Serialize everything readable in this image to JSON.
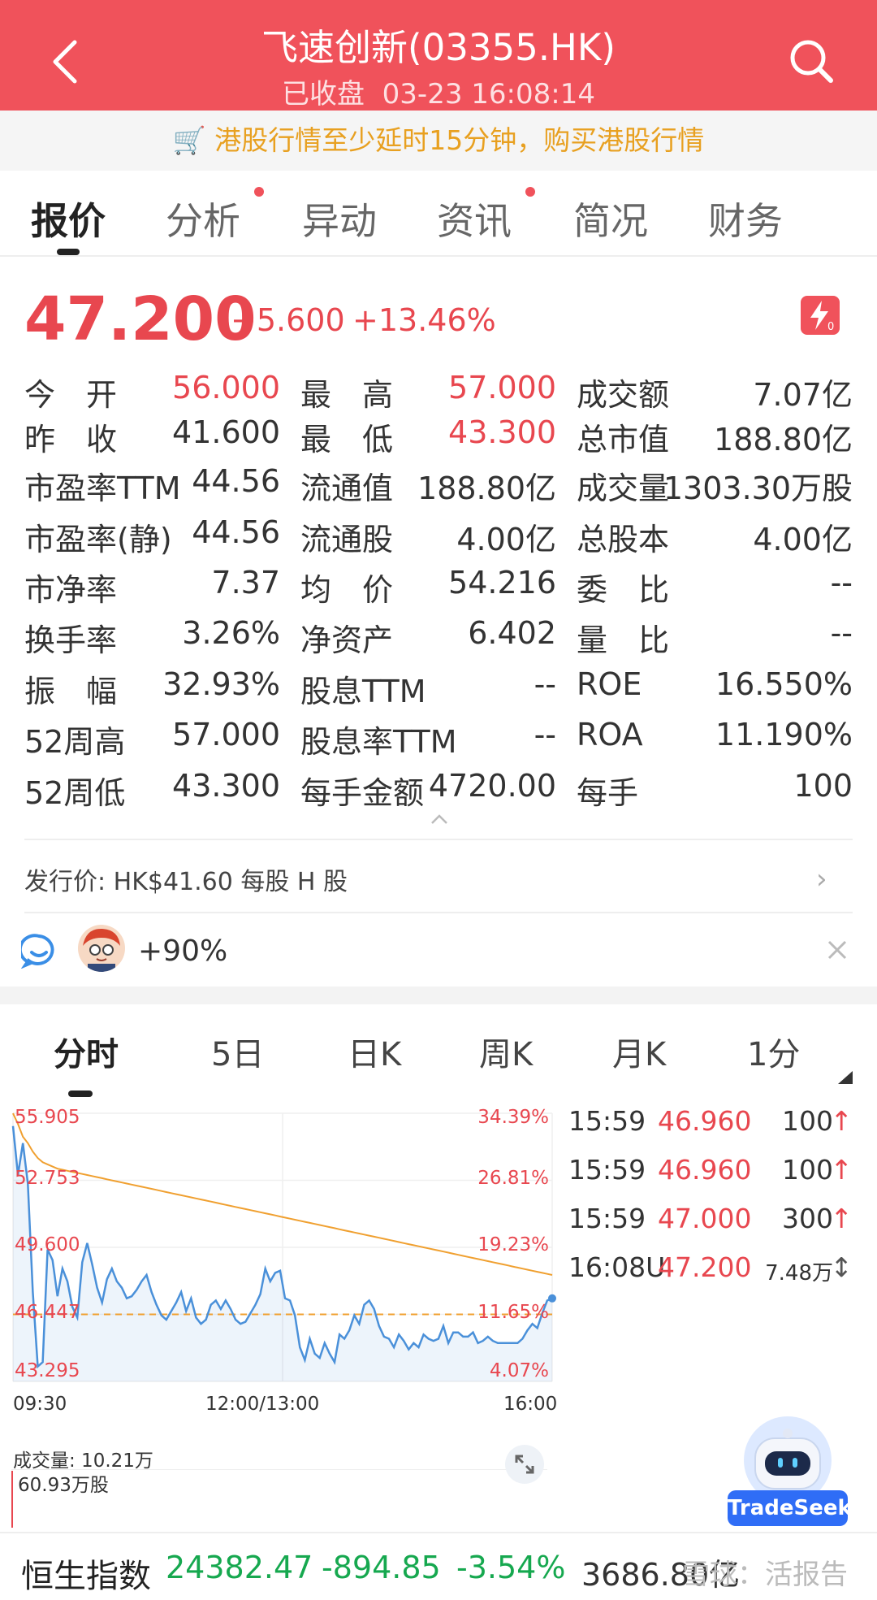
{
  "header": {
    "title": "飞速创新(03355.HK)",
    "status": "已收盘",
    "datetime": "03-23  16:08:14"
  },
  "notice": {
    "text": "港股行情至少延时15分钟，购买港股行情"
  },
  "tabs": [
    {
      "label": "报价"
    },
    {
      "label": "分析"
    },
    {
      "label": "异动"
    },
    {
      "label": "资讯"
    },
    {
      "label": "简况"
    },
    {
      "label": "财务"
    }
  ],
  "quote": {
    "price": "47.200",
    "change": "+5.600",
    "change_pct": "+13.46%",
    "flash_badge": "0"
  },
  "stats": [
    [
      "今　开",
      "56.000",
      "最　高",
      "57.000",
      "成交额",
      "7.07亿"
    ],
    [
      "昨　收",
      "41.600",
      "最　低",
      "43.300",
      "总市值",
      "188.80亿"
    ],
    [
      "市盈率TTM",
      "44.56",
      "流通值",
      "188.80亿",
      "成交量",
      "1303.30万股"
    ],
    [
      "市盈率(静)",
      "44.56",
      "流通股",
      "4.00亿",
      "总股本",
      "4.00亿"
    ],
    [
      "市净率",
      "7.37",
      "均　价",
      "54.216",
      "委　比",
      "--"
    ],
    [
      "换手率",
      "3.26%",
      "净资产",
      "6.402",
      "量　比",
      "--"
    ],
    [
      "振　幅",
      "32.93%",
      "股息TTM",
      "--",
      "ROE",
      "16.550%"
    ],
    [
      "52周高",
      "57.000",
      "股息率TTM",
      "--",
      "ROA",
      "11.190%"
    ],
    [
      "52周低",
      "43.300",
      "每手金额",
      "4720.00",
      "每手",
      "100"
    ]
  ],
  "issue": {
    "text": "发行价: HK$41.60 每股 H 股"
  },
  "sentiment": {
    "text": "+90%"
  },
  "chart_tabs": [
    {
      "label": "分时"
    },
    {
      "label": "5日"
    },
    {
      "label": "日K"
    },
    {
      "label": "周K"
    },
    {
      "label": "月K"
    },
    {
      "label": "1分"
    }
  ],
  "chart_data": {
    "type": "line",
    "y_labels": [
      "55.905",
      "52.753",
      "49.600",
      "46.447",
      "43.295"
    ],
    "y_pct_labels": [
      "34.39%",
      "26.81%",
      "19.23%",
      "11.65%",
      "4.07%"
    ],
    "x_labels": [
      "09:30",
      "12:00/13:00",
      "16:00"
    ],
    "ylim": [
      43.295,
      55.905
    ],
    "prev_close": 46.447,
    "series": [
      {
        "values": [
          55.3,
          53.0,
          54.5,
          52.6,
          47.5,
          44.0,
          44.2,
          49.5,
          49.0,
          47.3,
          48.6,
          48.0,
          46.8,
          46.3,
          48.9,
          49.8,
          48.8,
          47.7,
          47.0,
          48.1,
          48.6,
          48.0,
          47.7,
          47.2,
          47.3,
          47.6,
          48.0,
          48.3,
          47.5,
          46.9,
          46.4,
          46.2,
          46.6,
          47.0,
          47.5,
          46.6,
          47.2,
          46.3,
          46.0,
          46.2,
          46.9,
          47.1,
          46.7,
          47.1,
          46.7,
          46.2,
          46.0,
          46.1,
          46.5,
          46.9,
          47.4,
          48.6,
          48.0,
          48.4,
          48.5,
          47.2,
          47.1,
          46.4,
          44.9,
          44.3,
          45.3,
          44.6,
          44.4,
          45.1,
          44.6,
          44.2,
          45.5,
          45.3,
          45.7,
          46.4,
          46.0,
          46.9,
          47.1,
          46.7,
          45.9,
          45.4,
          45.3,
          44.9,
          45.5,
          45.2,
          44.8,
          45.1,
          44.9,
          45.5,
          45.3,
          45.2,
          45.3,
          45.9,
          45.1,
          45.6,
          45.6,
          45.4,
          45.4,
          45.6,
          45.1,
          45.2,
          45.4,
          45.2,
          45.1,
          45.1,
          45.1,
          45.1,
          45.1,
          45.3,
          45.7,
          46.0,
          45.8,
          46.5,
          47.1,
          47.2
        ]
      },
      {
        "values": [
          55.9,
          55.4,
          54.8,
          54.5,
          54.1,
          53.8,
          53.6,
          53.5,
          53.4,
          53.3,
          53.25,
          53.2,
          53.15,
          53.1,
          53.05,
          53.0,
          52.95,
          52.9,
          52.85,
          52.8,
          52.75,
          52.7,
          52.65,
          52.6,
          52.55,
          52.5,
          52.45,
          52.4,
          52.35,
          52.3,
          52.25,
          52.2,
          52.15,
          52.1,
          52.05,
          52.0,
          51.95,
          51.9,
          51.85,
          51.8,
          51.75,
          51.7,
          51.65,
          51.6,
          51.55,
          51.5,
          51.45,
          51.4,
          51.35,
          51.3,
          51.25,
          51.2,
          51.15,
          51.1,
          51.05,
          51.0,
          50.95,
          50.9,
          50.85,
          50.8,
          50.75,
          50.7,
          50.65,
          50.6,
          50.55,
          50.5,
          50.45,
          50.4,
          50.35,
          50.3,
          50.25,
          50.2,
          50.15,
          50.1,
          50.05,
          50.0,
          49.95,
          49.9,
          49.85,
          49.8,
          49.75,
          49.7,
          49.65,
          49.6,
          49.55,
          49.5,
          49.45,
          49.4,
          49.35,
          49.3,
          49.25,
          49.2,
          49.15,
          49.1,
          49.05,
          49.0,
          48.95,
          48.9,
          48.85,
          48.8,
          48.75,
          48.7,
          48.65,
          48.6,
          48.55,
          48.5,
          48.45,
          48.4,
          48.35,
          48.3
        ]
      }
    ],
    "colors": {
      "price": "#4a90d9",
      "avg": "#f0a030",
      "prev_close": "#f0a030"
    }
  },
  "ticks": [
    {
      "time": "15:59",
      "price": "46.960",
      "vol": "100",
      "dir": "↑"
    },
    {
      "time": "15:59",
      "price": "46.960",
      "vol": "100",
      "dir": "↑"
    },
    {
      "time": "15:59",
      "price": "47.000",
      "vol": "300",
      "dir": "↑"
    },
    {
      "time": "16:08U",
      "price": "47.200",
      "vol": "7.48万",
      "dir": "↕"
    }
  ],
  "volume": {
    "label": "成交量: 10.21万",
    "max": "60.93万股"
  },
  "robot": {
    "label": "TradeSeek"
  },
  "index_bar": {
    "name": "恒生指数",
    "value": "24382.47",
    "change": "-894.85",
    "pct": "-3.54%",
    "turnover": "3686.80亿"
  },
  "watermark": "雪球：活报告"
}
